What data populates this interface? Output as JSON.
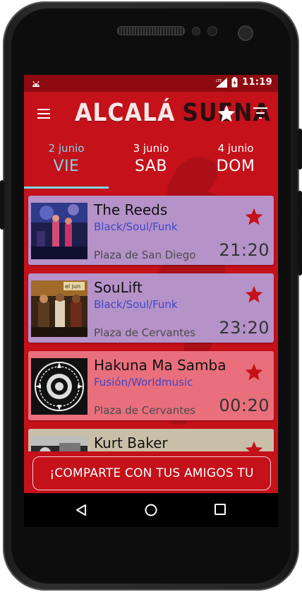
{
  "status_bar": {
    "network": "LTE",
    "time": "11:19"
  },
  "toolbar": {
    "logo_part1": "ALCALÁ",
    "logo_part2": "SUENA",
    "menu_icon": "hamburger-menu-icon",
    "favorites_icon": "star-icon",
    "filter_icon": "filter-icon"
  },
  "tabs": [
    {
      "date": "2 junio",
      "day": "VIE",
      "selected": true
    },
    {
      "date": "3 junio",
      "day": "SAB",
      "selected": false
    },
    {
      "date": "4 junio",
      "day": "DOM",
      "selected": false
    }
  ],
  "events": [
    {
      "name": "The Reeds",
      "genre": "Black/Soul/Funk",
      "venue": "Plaza de San Diego",
      "time": "21:20",
      "card_color": "#b592c8"
    },
    {
      "name": "SouLift",
      "genre": "Black/Soul/Funk",
      "venue": "Plaza de Cervantes",
      "time": "23:20",
      "card_color": "#b592c8"
    },
    {
      "name": "Hakuna Ma Samba",
      "genre": "Fusión/Worldmusic",
      "venue": "Plaza de Cervantes",
      "time": "00:20",
      "card_color": "#ea6f7c"
    },
    {
      "name": "Kurt Baker",
      "genre": "",
      "venue": "",
      "time": "",
      "card_color": "#c9bfa9"
    }
  ],
  "share_button": {
    "label": "¡COMPARTE CON TUS AMIGOS TU LISTA!"
  },
  "nav": {
    "back": "back-icon",
    "home": "home-icon",
    "recent": "recent-apps-icon"
  },
  "colors": {
    "primary": "#c4111a",
    "accent": "#7fd6e6",
    "fav_star": "#c4111a"
  }
}
